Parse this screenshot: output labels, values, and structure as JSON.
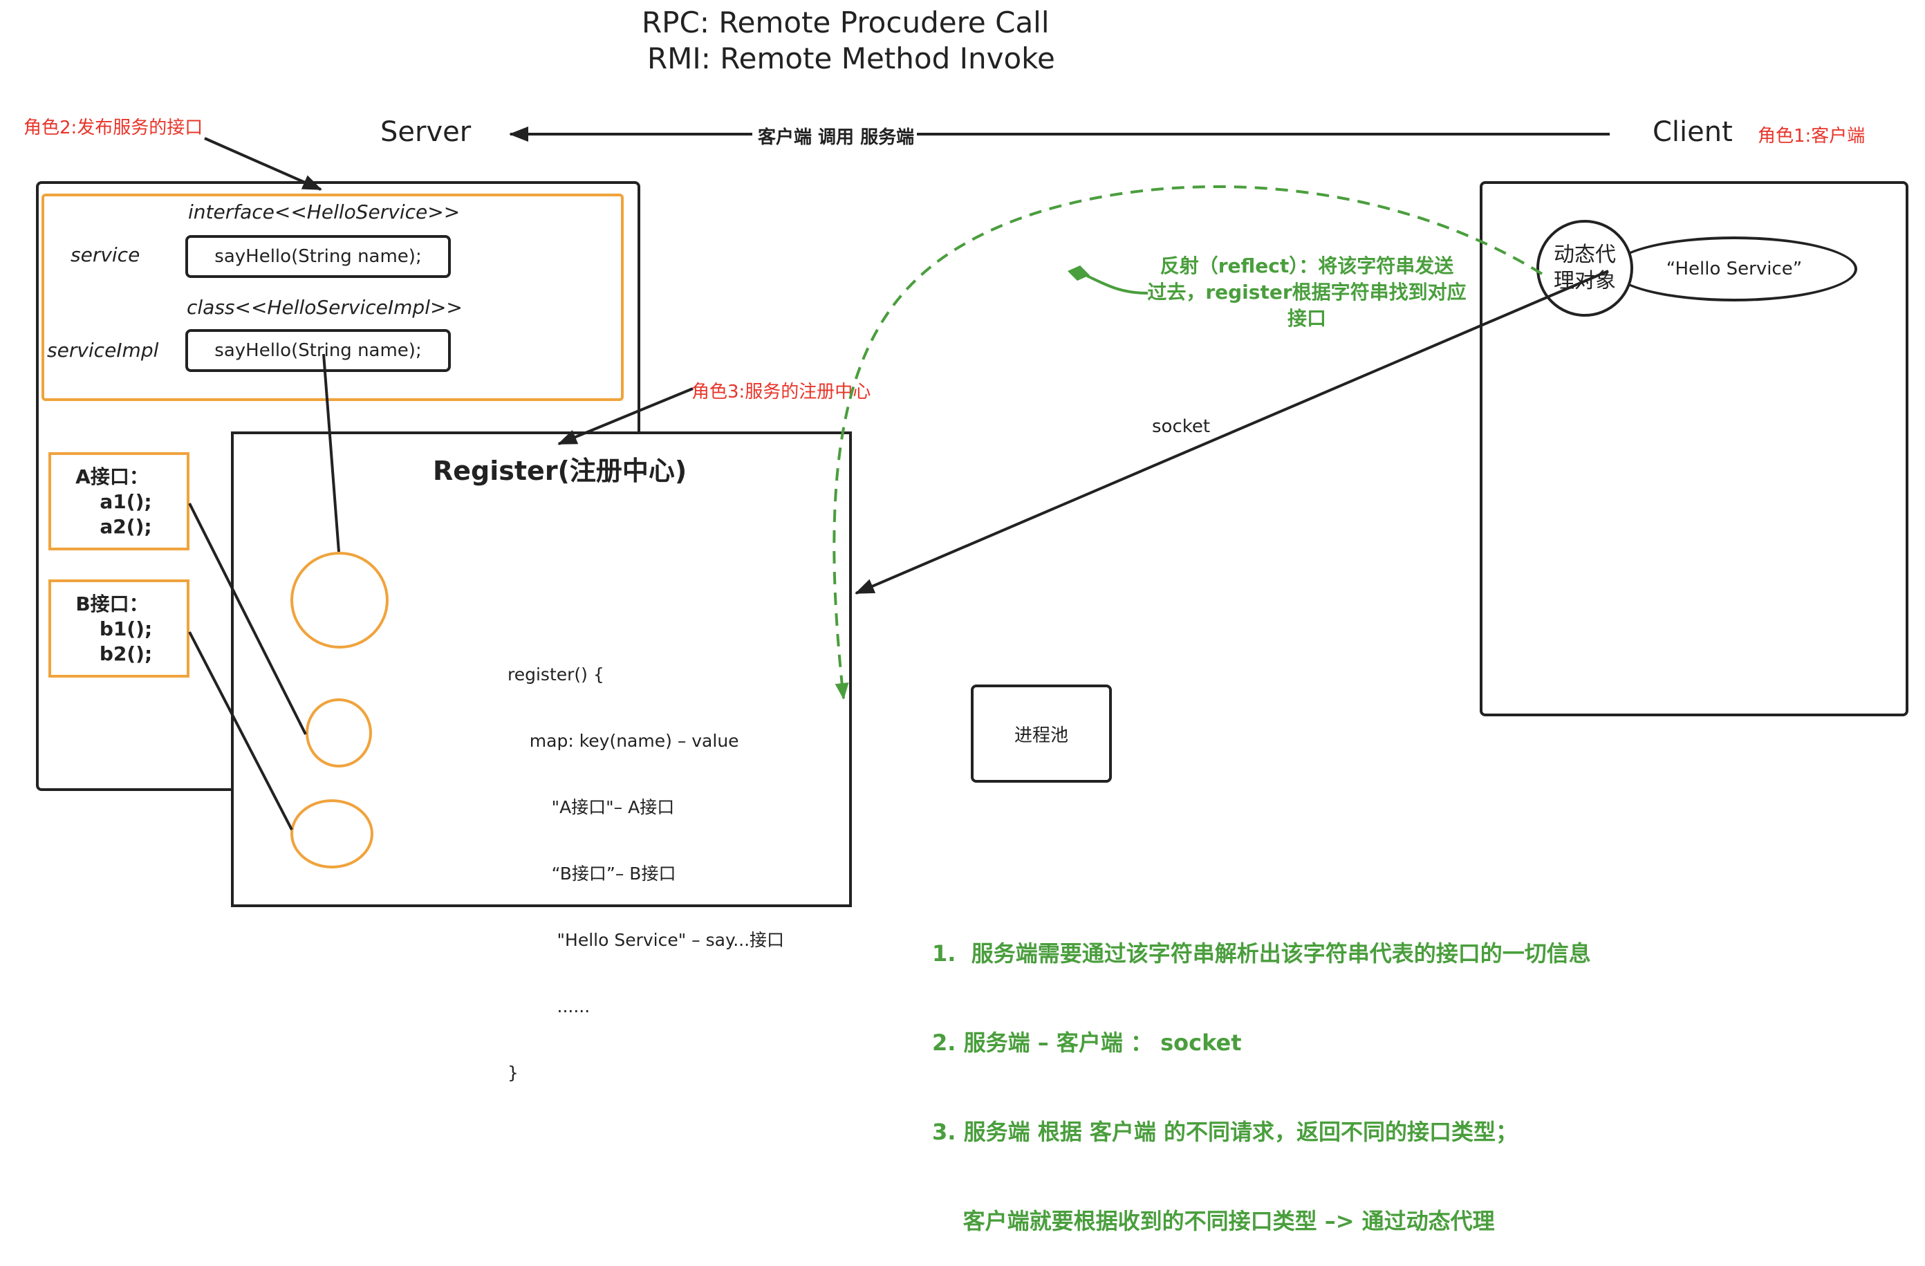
{
  "title": {
    "line1": "RPC: Remote Procudere Call",
    "line2": "RMI: Remote Method Invoke"
  },
  "server": {
    "heading": "Server",
    "role_label": "角色2:发布服务的接口",
    "interface_label": "interface<<HelloService>>",
    "service_label": "service",
    "service_method": "sayHello(String name);",
    "class_label": "class<<HelloServiceImpl>>",
    "impl_label": "serviceImpl",
    "impl_method": "sayHello(String name);",
    "a_interface": {
      "title": "A接口：",
      "methods": [
        "a1();",
        "a2();"
      ]
    },
    "b_interface": {
      "title": "B接口：",
      "methods": [
        "b1();",
        "b2();"
      ]
    }
  },
  "arrow_call_label": "客户端 调用 服务端",
  "client": {
    "heading": "Client",
    "role_label": "角色1:客户端",
    "proxy_label": "动态代\n理对象",
    "hello_service": "“Hello Service”"
  },
  "register": {
    "role_label": "角色3:服务的注册中心",
    "title": "Register(注册中心)",
    "code_lines": [
      "register() {",
      "    map: key(name) – value",
      "        \"A接口\"– A接口",
      "        “B接口”– B接口",
      "         \"Hello Service\" – say...接口",
      "         ......",
      "}"
    ]
  },
  "reflect_note": {
    "line1": "反射（reflect）：将该字符串发送",
    "line2": "过去，register根据字符串找到对应",
    "line3": "接口"
  },
  "socket_label": "socket",
  "process_pool": "进程池",
  "notes": [
    "1.  服务端需要通过该字符串解析出该字符串代表的接口的一切信息",
    "2. 服务端 – 客户端 ： socket",
    "3. 服务端 根据 客户端 的不同请求，返回不同的接口类型；",
    "    客户端就要根据收到的不同接口类型 –> 通过动态代理"
  ],
  "colors": {
    "orange": "#f0a33c",
    "green": "#4a9e3d",
    "red": "#e8352a",
    "black": "#222222"
  }
}
